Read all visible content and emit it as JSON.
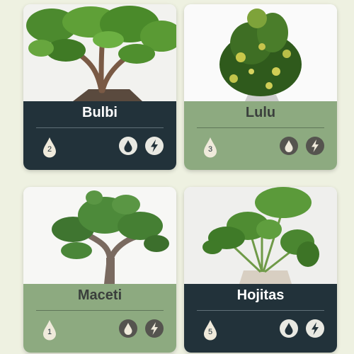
{
  "colors": {
    "background": "#eef1e1",
    "dark_panel": "#22323a",
    "light_panel": "#8daa80",
    "drop_fill": "#efeadb"
  },
  "plants": [
    {
      "name": "Bulbi",
      "water_level": "2",
      "theme": "dark",
      "icons": [
        "water-drop-icon",
        "lightning-icon"
      ]
    },
    {
      "name": "Lulu",
      "water_level": "3",
      "theme": "light",
      "icons": [
        "water-drop-icon",
        "lightning-icon"
      ]
    },
    {
      "name": "Maceti",
      "water_level": "1",
      "theme": "light",
      "icons": [
        "water-drop-icon",
        "lightning-icon"
      ]
    },
    {
      "name": "Hojitas",
      "water_level": "5",
      "theme": "dark",
      "icons": [
        "water-drop-icon",
        "lightning-icon"
      ]
    }
  ]
}
